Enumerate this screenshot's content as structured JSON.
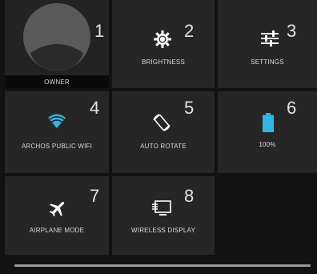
{
  "tiles": [
    {
      "id": "owner",
      "label": "OWNER",
      "number": "1",
      "icon": "avatar"
    },
    {
      "id": "brightness",
      "label": "BRIGHTNESS",
      "number": "2",
      "icon": "brightness-icon"
    },
    {
      "id": "settings",
      "label": "SETTINGS",
      "number": "3",
      "icon": "sliders-icon"
    },
    {
      "id": "wifi",
      "label": "ARCHOS PUBLIC WIFI",
      "number": "4",
      "icon": "wifi-icon"
    },
    {
      "id": "auto-rotate",
      "label": "AUTO ROTATE",
      "number": "5",
      "icon": "rotate-icon"
    },
    {
      "id": "battery",
      "label": "100%",
      "number": "6",
      "icon": "battery-icon",
      "level": 1.0
    },
    {
      "id": "airplane",
      "label": "AIRPLANE MODE",
      "number": "7",
      "icon": "airplane-icon"
    },
    {
      "id": "wireless-display",
      "label": "WIRELESS DISPLAY",
      "number": "8",
      "icon": "cast-icon"
    }
  ],
  "colors": {
    "background": "#121212",
    "tile": "#262626",
    "accent": "#33b5e5",
    "text": "#d8d8d8",
    "icon": "#ffffff"
  }
}
